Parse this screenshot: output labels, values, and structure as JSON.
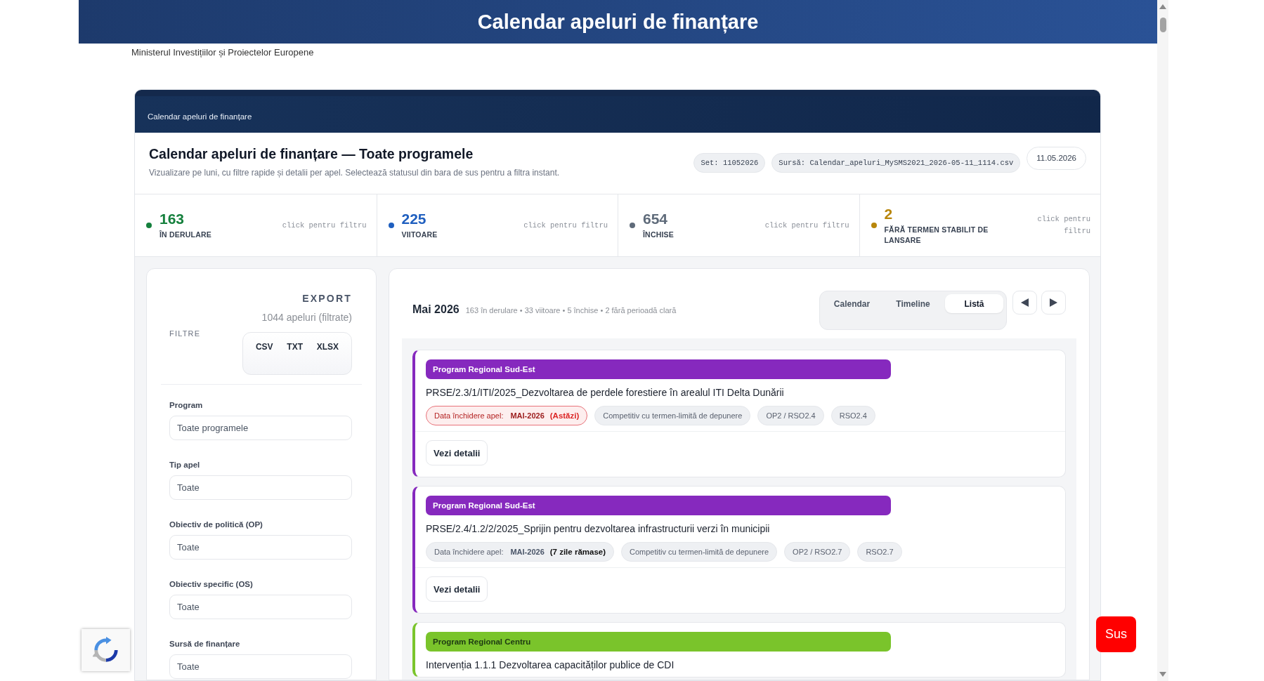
{
  "header": {
    "title": "Calendar apeluri de finanțare",
    "subtitle": "Ministerul Investițiilor și Proiectelor Europene"
  },
  "app": {
    "banner": "Calendar apeluri de finanțare",
    "title": "Calendar apeluri de finanțare — Toate programele",
    "description": "Vizualizare pe luni, cu filtre rapide și detalii per apel. Selectează statusul din bara de sus pentru a filtra instant.",
    "badges": [
      {
        "kind": "code",
        "text": "Set: 11052026"
      },
      {
        "kind": "code",
        "text": "Sursă: Calendar_apeluri_MySMS2021_2026-05-11_1114.csv"
      },
      {
        "kind": "date",
        "text": "11.05.2026"
      }
    ]
  },
  "stats": [
    {
      "value": "163",
      "label": "ÎN DERULARE",
      "hint": "click pentru filtru",
      "color": "#15803d"
    },
    {
      "value": "225",
      "label": "VIITOARE",
      "hint": "click pentru filtru",
      "color": "#1f5fbf"
    },
    {
      "value": "654",
      "label": "ÎNCHISE",
      "hint": "click pentru filtru",
      "color": "#5f6b7a"
    },
    {
      "value": "2",
      "label": "FĂRĂ TERMEN STABILIT DE LANSARE",
      "hint": "click pentru filtru",
      "color": "#b8860b"
    }
  ],
  "sidebar": {
    "export_title": "EXPORT",
    "count": "1044 apeluri (filtrate)",
    "filters_title": "FILTRE",
    "export_formats": [
      "CSV",
      "TXT",
      "XLSX"
    ],
    "filters": [
      {
        "label": "Program",
        "value": "Toate programele"
      },
      {
        "label": "Tip apel",
        "value": "Toate"
      },
      {
        "label": "Obiectiv de politică (OP)",
        "value": "Toate"
      },
      {
        "label": "Obiectiv specific (OS)",
        "value": "Toate"
      },
      {
        "label": "Sursă de finanțare",
        "value": "Toate"
      }
    ]
  },
  "calendar": {
    "month": "Mai 2026",
    "summary": "163 în derulare • 33 viitoare • 5 închise • 2 fără perioadă clară",
    "views": [
      {
        "label": "Calendar",
        "selected": false
      },
      {
        "label": "Timeline",
        "selected": false
      },
      {
        "label": "Listă",
        "selected": true
      }
    ],
    "calls": [
      {
        "program": "Program Regional Sud-Est",
        "color": "#8629be",
        "title": "PRSE/2.3/1/ITI/2025_Dezvoltarea de perdele forestiere în arealul ITI Delta Dunării",
        "deadline": {
          "label": "Data închidere apel:",
          "date": "MAI-2026",
          "note": "(Astăzi)",
          "urgent": true
        },
        "tags": [
          "Competitiv cu termen-limită de depunere",
          "OP2 / RSO2.4",
          "RSO2.4"
        ],
        "action": "Vezi detalii"
      },
      {
        "program": "Program Regional Sud-Est",
        "color": "#8629be",
        "title": "PRSE/2.4/1.2/2/2025_Sprijin pentru dezvoltarea infrastructurii verzi în municipii",
        "deadline": {
          "label": "Data închidere apel:",
          "date": "MAI-2026",
          "note": "(7 zile rămase)",
          "urgent": false
        },
        "tags": [
          "Competitiv cu termen-limită de depunere",
          "OP2 / RSO2.7",
          "RSO2.7"
        ],
        "action": "Vezi detalii"
      },
      {
        "program": "Program Regional Centru",
        "color": "#7ac42b",
        "title": "Intervenția 1.1.1 Dezvoltarea capacităților publice de CDI"
      }
    ]
  },
  "back_to_top": "Sus"
}
